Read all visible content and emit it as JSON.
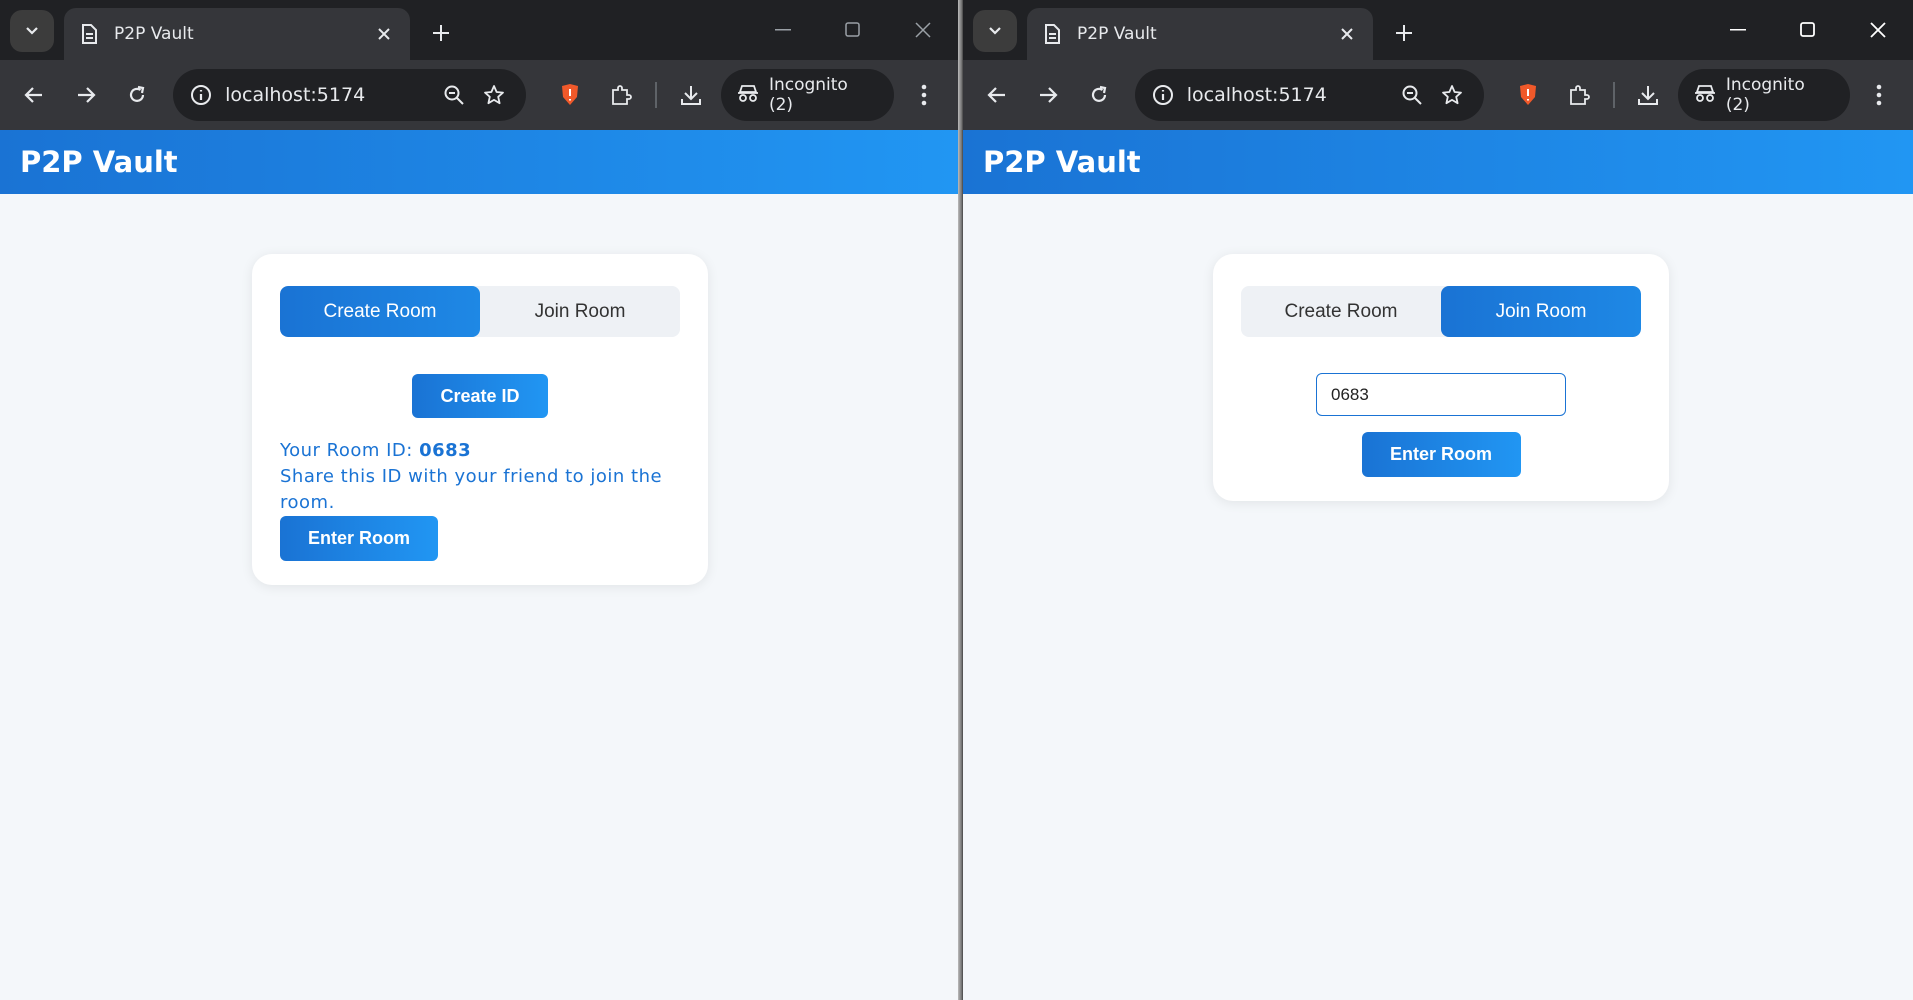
{
  "browser": {
    "tab_title": "P2P Vault",
    "url": "localhost:5174",
    "incognito_label": "Incognito (2)",
    "icons": [
      "tab-search-icon",
      "favicon-icon",
      "close-icon",
      "plus-icon",
      "minimize-icon",
      "maximize-icon",
      "back-icon",
      "forward-icon",
      "reload-icon",
      "info-icon",
      "zoom-icon",
      "star-icon",
      "brave-shield-icon",
      "extensions-icon",
      "download-icon",
      "incognito-icon",
      "menu-icon"
    ]
  },
  "app": {
    "title": "P2P Vault"
  },
  "left": {
    "tabs": [
      {
        "label": "Create Room",
        "active": true
      },
      {
        "label": "Join Room",
        "active": false
      }
    ],
    "create_id_label": "Create ID",
    "room_id_prefix": "Your Room ID: ",
    "room_id": "0683",
    "share_text": "Share this ID with your friend to join the room.",
    "enter_room_label": "Enter Room"
  },
  "right": {
    "tabs": [
      {
        "label": "Create Room",
        "active": false
      },
      {
        "label": "Join Room",
        "active": true
      }
    ],
    "room_input_value": "0683",
    "enter_room_label": "Enter Room"
  },
  "colors": {
    "accent": "#1a73d4",
    "accent_light": "#2196f3",
    "page_bg": "#f4f7fa",
    "brave_shield": "#f0592a"
  }
}
